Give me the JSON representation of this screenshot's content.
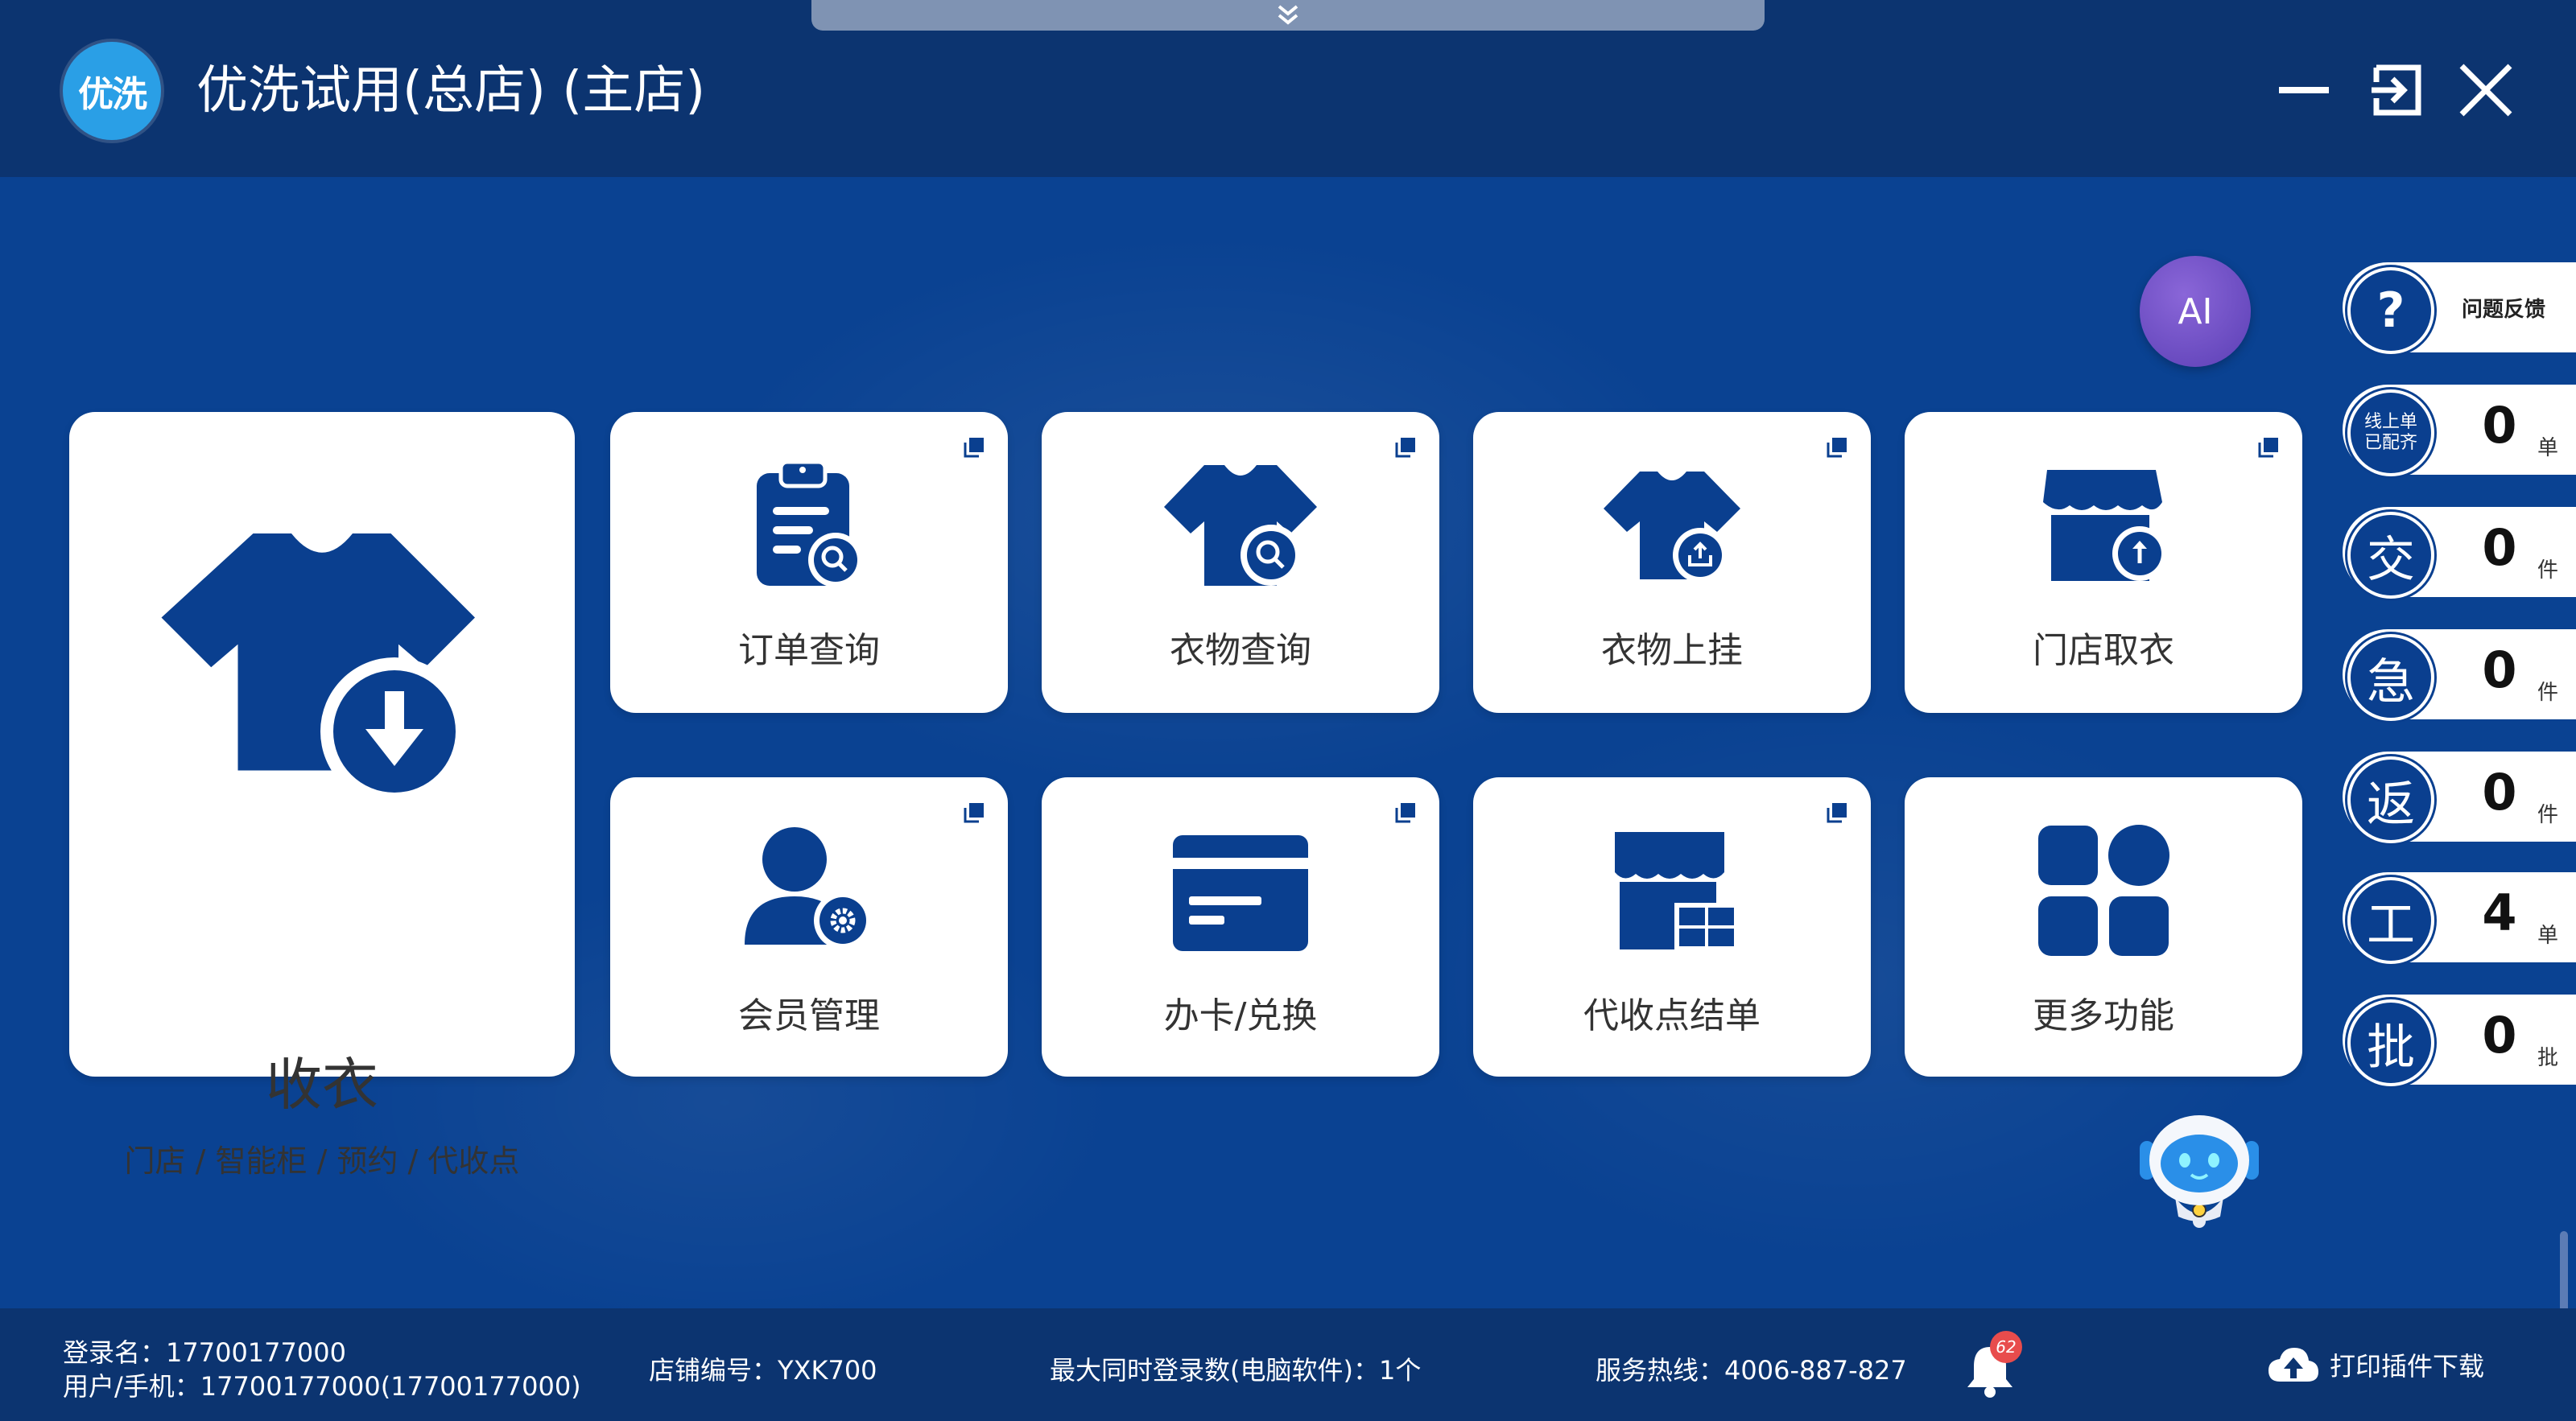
{
  "app": {
    "logo_text": "优洗",
    "title": "优洗试用(总店) (主店)"
  },
  "main_card": {
    "title": "收衣",
    "subtitle": "门店 / 智能柜 / 预约 / 代收点"
  },
  "cards": [
    {
      "label": "订单查询"
    },
    {
      "label": "衣物查询"
    },
    {
      "label": "衣物上挂"
    },
    {
      "label": "门店取衣"
    },
    {
      "label": "会员管理"
    },
    {
      "label": "办卡/兑换"
    },
    {
      "label": "代收点结单"
    },
    {
      "label": "更多功能"
    }
  ],
  "ai_button": {
    "label": "AI"
  },
  "side_panel": {
    "feedback": {
      "icon": "?",
      "label": "问题反馈"
    },
    "items": [
      {
        "icon_line1": "线上单",
        "icon_line2": "已配齐",
        "count": "0",
        "unit": "单"
      },
      {
        "icon": "交",
        "count": "0",
        "unit": "件"
      },
      {
        "icon": "急",
        "count": "0",
        "unit": "件"
      },
      {
        "icon": "返",
        "count": "0",
        "unit": "件"
      },
      {
        "icon": "工",
        "count": "4",
        "unit": "单"
      },
      {
        "icon": "批",
        "count": "0",
        "unit": "批"
      }
    ]
  },
  "status": {
    "login_name": "登录名：17700177000",
    "user_phone": "用户/手机：17700177000(17700177000)",
    "shop_code": "店铺编号：YXK700",
    "max_logins": "最大同时登录数(电脑软件)：1个",
    "hotline": "服务热线：4006-887-827",
    "notification_count": "62",
    "plugin_download": "打印插件下载"
  },
  "colors": {
    "primary": "#0a4292",
    "titlebar": "#0c3470",
    "card": "#ffffff",
    "icon": "#0a3f8f",
    "badge": "#e84c4c"
  }
}
